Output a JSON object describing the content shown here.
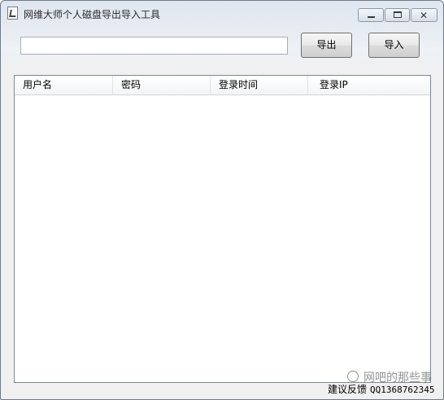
{
  "window": {
    "title": "网维大师个人磁盘导出导入工具",
    "min_label": "—",
    "close_label": "✕"
  },
  "toolbar": {
    "path_value": "",
    "export_label": "导出",
    "import_label": "导入"
  },
  "table": {
    "columns": [
      "用户名",
      "密码",
      "登录时间",
      "登录IP"
    ],
    "rows": []
  },
  "footer": {
    "feedback_label": "建议反馈",
    "qq_text": "QQ1368762345"
  },
  "watermark": {
    "text": "网吧的那些事",
    "icon": "wechat-icon"
  }
}
